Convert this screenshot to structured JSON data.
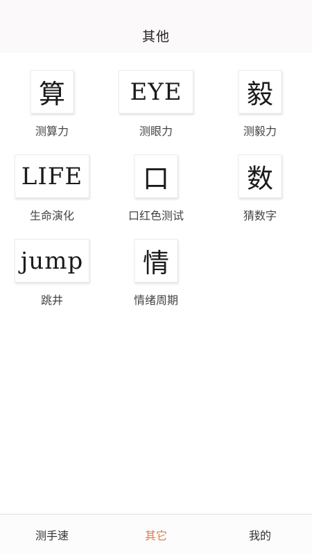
{
  "header": {
    "title": "其他"
  },
  "tiles": [
    {
      "glyph": "算",
      "label": "测算力"
    },
    {
      "glyph": "EYE",
      "label": "测眼力"
    },
    {
      "glyph": "毅",
      "label": "测毅力"
    },
    {
      "glyph": "LIFE",
      "label": "生命演化"
    },
    {
      "glyph": "口",
      "label": "口红色测试"
    },
    {
      "glyph": "数",
      "label": "猜数字"
    },
    {
      "glyph": "jump",
      "label": "跳井"
    },
    {
      "glyph": "情",
      "label": "情绪周期"
    }
  ],
  "tabbar": {
    "tabs": [
      {
        "label": "测手速",
        "active": false
      },
      {
        "label": "其它",
        "active": true
      },
      {
        "label": "我的",
        "active": false
      }
    ],
    "active_color": "#e07a4c"
  }
}
